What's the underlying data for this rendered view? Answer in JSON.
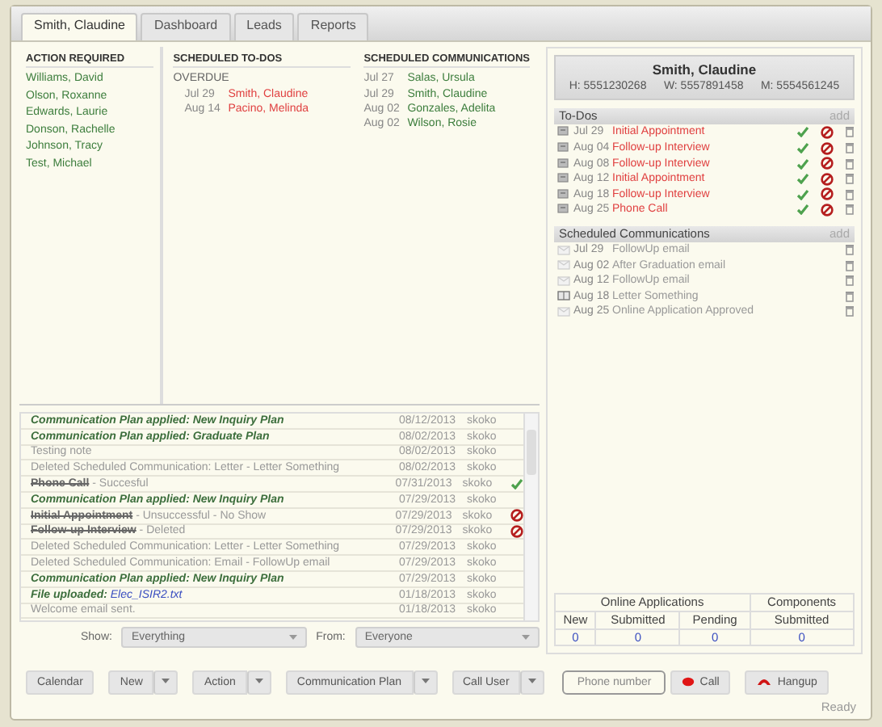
{
  "tabs": [
    {
      "label": "Smith, Claudine",
      "selected": true
    },
    {
      "label": "Dashboard",
      "selected": false
    },
    {
      "label": "Leads",
      "selected": false
    },
    {
      "label": "Reports",
      "selected": false
    }
  ],
  "action_required": {
    "title": "ACTION REQUIRED",
    "names": [
      "Williams, David",
      "Olson, Roxanne",
      "Edwards, Laurie",
      "Donson, Rachelle",
      "Johnson, Tracy",
      "Test, Michael"
    ]
  },
  "scheduled_todos": {
    "title": "SCHEDULED TO-DOS",
    "groups": [
      {
        "label": "OVERDUE",
        "items": [
          {
            "date": "Jul 29",
            "name": "Smith, Claudine"
          },
          {
            "date": "Aug 14",
            "name": "Pacino, Melinda"
          }
        ]
      }
    ]
  },
  "scheduled_communications": {
    "title": "SCHEDULED COMMUNICATIONS",
    "items": [
      {
        "date": "Jul 27",
        "name": "Salas, Ursula"
      },
      {
        "date": "Jul 29",
        "name": "Smith, Claudine"
      },
      {
        "date": "Aug 02",
        "name": "Gonzales, Adelita"
      },
      {
        "date": "Aug 02",
        "name": "Wilson, Rosie"
      }
    ]
  },
  "history": {
    "rows": [
      {
        "kind": "plan",
        "text": "Communication Plan applied: New Inquiry Plan",
        "date": "08/12/2013",
        "user": "skoko"
      },
      {
        "kind": "plan",
        "text": "Communication Plan applied: Graduate Plan",
        "date": "08/02/2013",
        "user": "skoko"
      },
      {
        "kind": "note",
        "text": "Testing note",
        "date": "08/02/2013",
        "user": "skoko"
      },
      {
        "kind": "note",
        "text": "Deleted Scheduled Communication: Letter - Letter Something",
        "date": "08/02/2013",
        "user": "skoko"
      },
      {
        "kind": "todo",
        "task": "Phone Call",
        "result": " - Succesful",
        "date": "07/31/2013",
        "user": "skoko",
        "done": true
      },
      {
        "kind": "plan",
        "text": "Communication Plan applied: New Inquiry Plan",
        "date": "07/29/2013",
        "user": "skoko"
      },
      {
        "kind": "todo",
        "task": "Initial Appointment",
        "result": " - Unsuccessful - No Show",
        "date": "07/29/2013",
        "user": "skoko",
        "done": false
      },
      {
        "kind": "todo",
        "task": "Follow-up Interview",
        "result": " - Deleted",
        "date": "07/29/2013",
        "user": "skoko",
        "done": false
      },
      {
        "kind": "note",
        "text": "Deleted Scheduled Communication: Letter - Letter Something",
        "date": "07/29/2013",
        "user": "skoko"
      },
      {
        "kind": "note",
        "text": "Deleted Scheduled Communication: Email - FollowUp email",
        "date": "07/29/2013",
        "user": "skoko"
      },
      {
        "kind": "plan",
        "text": "Communication Plan applied: New Inquiry Plan",
        "date": "07/29/2013",
        "user": "skoko"
      },
      {
        "kind": "file",
        "label": "File uploaded: ",
        "file": "Elec_ISIR2.txt",
        "date": "01/18/2013",
        "user": "skoko"
      },
      {
        "kind": "note",
        "text": "Welcome email sent.",
        "date": "01/18/2013",
        "user": "skoko"
      }
    ]
  },
  "filters": [
    {
      "label": "Show:",
      "value": "Everything"
    },
    {
      "label": "From:",
      "value": "Everyone"
    }
  ],
  "contact": {
    "name": "Smith, Claudine",
    "phones": [
      "H: 5551230268",
      "W: 5557891458",
      "M: 5554561245"
    ]
  },
  "todos": {
    "title": "To-Dos",
    "add": "add",
    "items": [
      {
        "date": "Jul 29",
        "title": "Initial Appointment"
      },
      {
        "date": "Aug 04",
        "title": "Follow-up Interview"
      },
      {
        "date": "Aug 08",
        "title": "Follow-up Interview"
      },
      {
        "date": "Aug 12",
        "title": "Initial Appointment"
      },
      {
        "date": "Aug 18",
        "title": "Follow-up Interview"
      },
      {
        "date": "Aug 25",
        "title": "Phone Call"
      }
    ]
  },
  "communications": {
    "title": "Scheduled Communications",
    "add": "add",
    "items": [
      {
        "kind": "email",
        "date": "Jul 29",
        "title": "FollowUp email"
      },
      {
        "kind": "email",
        "date": "Aug 02",
        "title": "After Graduation email"
      },
      {
        "kind": "email",
        "date": "Aug 12",
        "title": "FollowUp email"
      },
      {
        "kind": "letter",
        "date": "Aug 18",
        "title": "Letter Something"
      },
      {
        "kind": "email",
        "date": "Aug 25",
        "title": "Online Application Approved"
      }
    ]
  },
  "applications": {
    "groups": [
      {
        "title": "Online Applications",
        "columns": [
          {
            "label": "New",
            "value": "0"
          },
          {
            "label": "Submitted",
            "value": "0"
          },
          {
            "label": "Pending",
            "value": "0"
          }
        ]
      },
      {
        "title": "Components",
        "columns": [
          {
            "label": "Submitted",
            "value": "0"
          }
        ]
      }
    ]
  },
  "toolbar": {
    "buttons": [
      {
        "label": "Calendar",
        "split": false
      },
      {
        "label": "New",
        "split": true
      },
      {
        "label": "Action",
        "split": true
      },
      {
        "label": "Communication Plan",
        "split": true
      },
      {
        "label": "Call User",
        "split": true
      }
    ],
    "phone_placeholder": "Phone number",
    "call": "Call",
    "hangup": "Hangup"
  },
  "status": "Ready"
}
